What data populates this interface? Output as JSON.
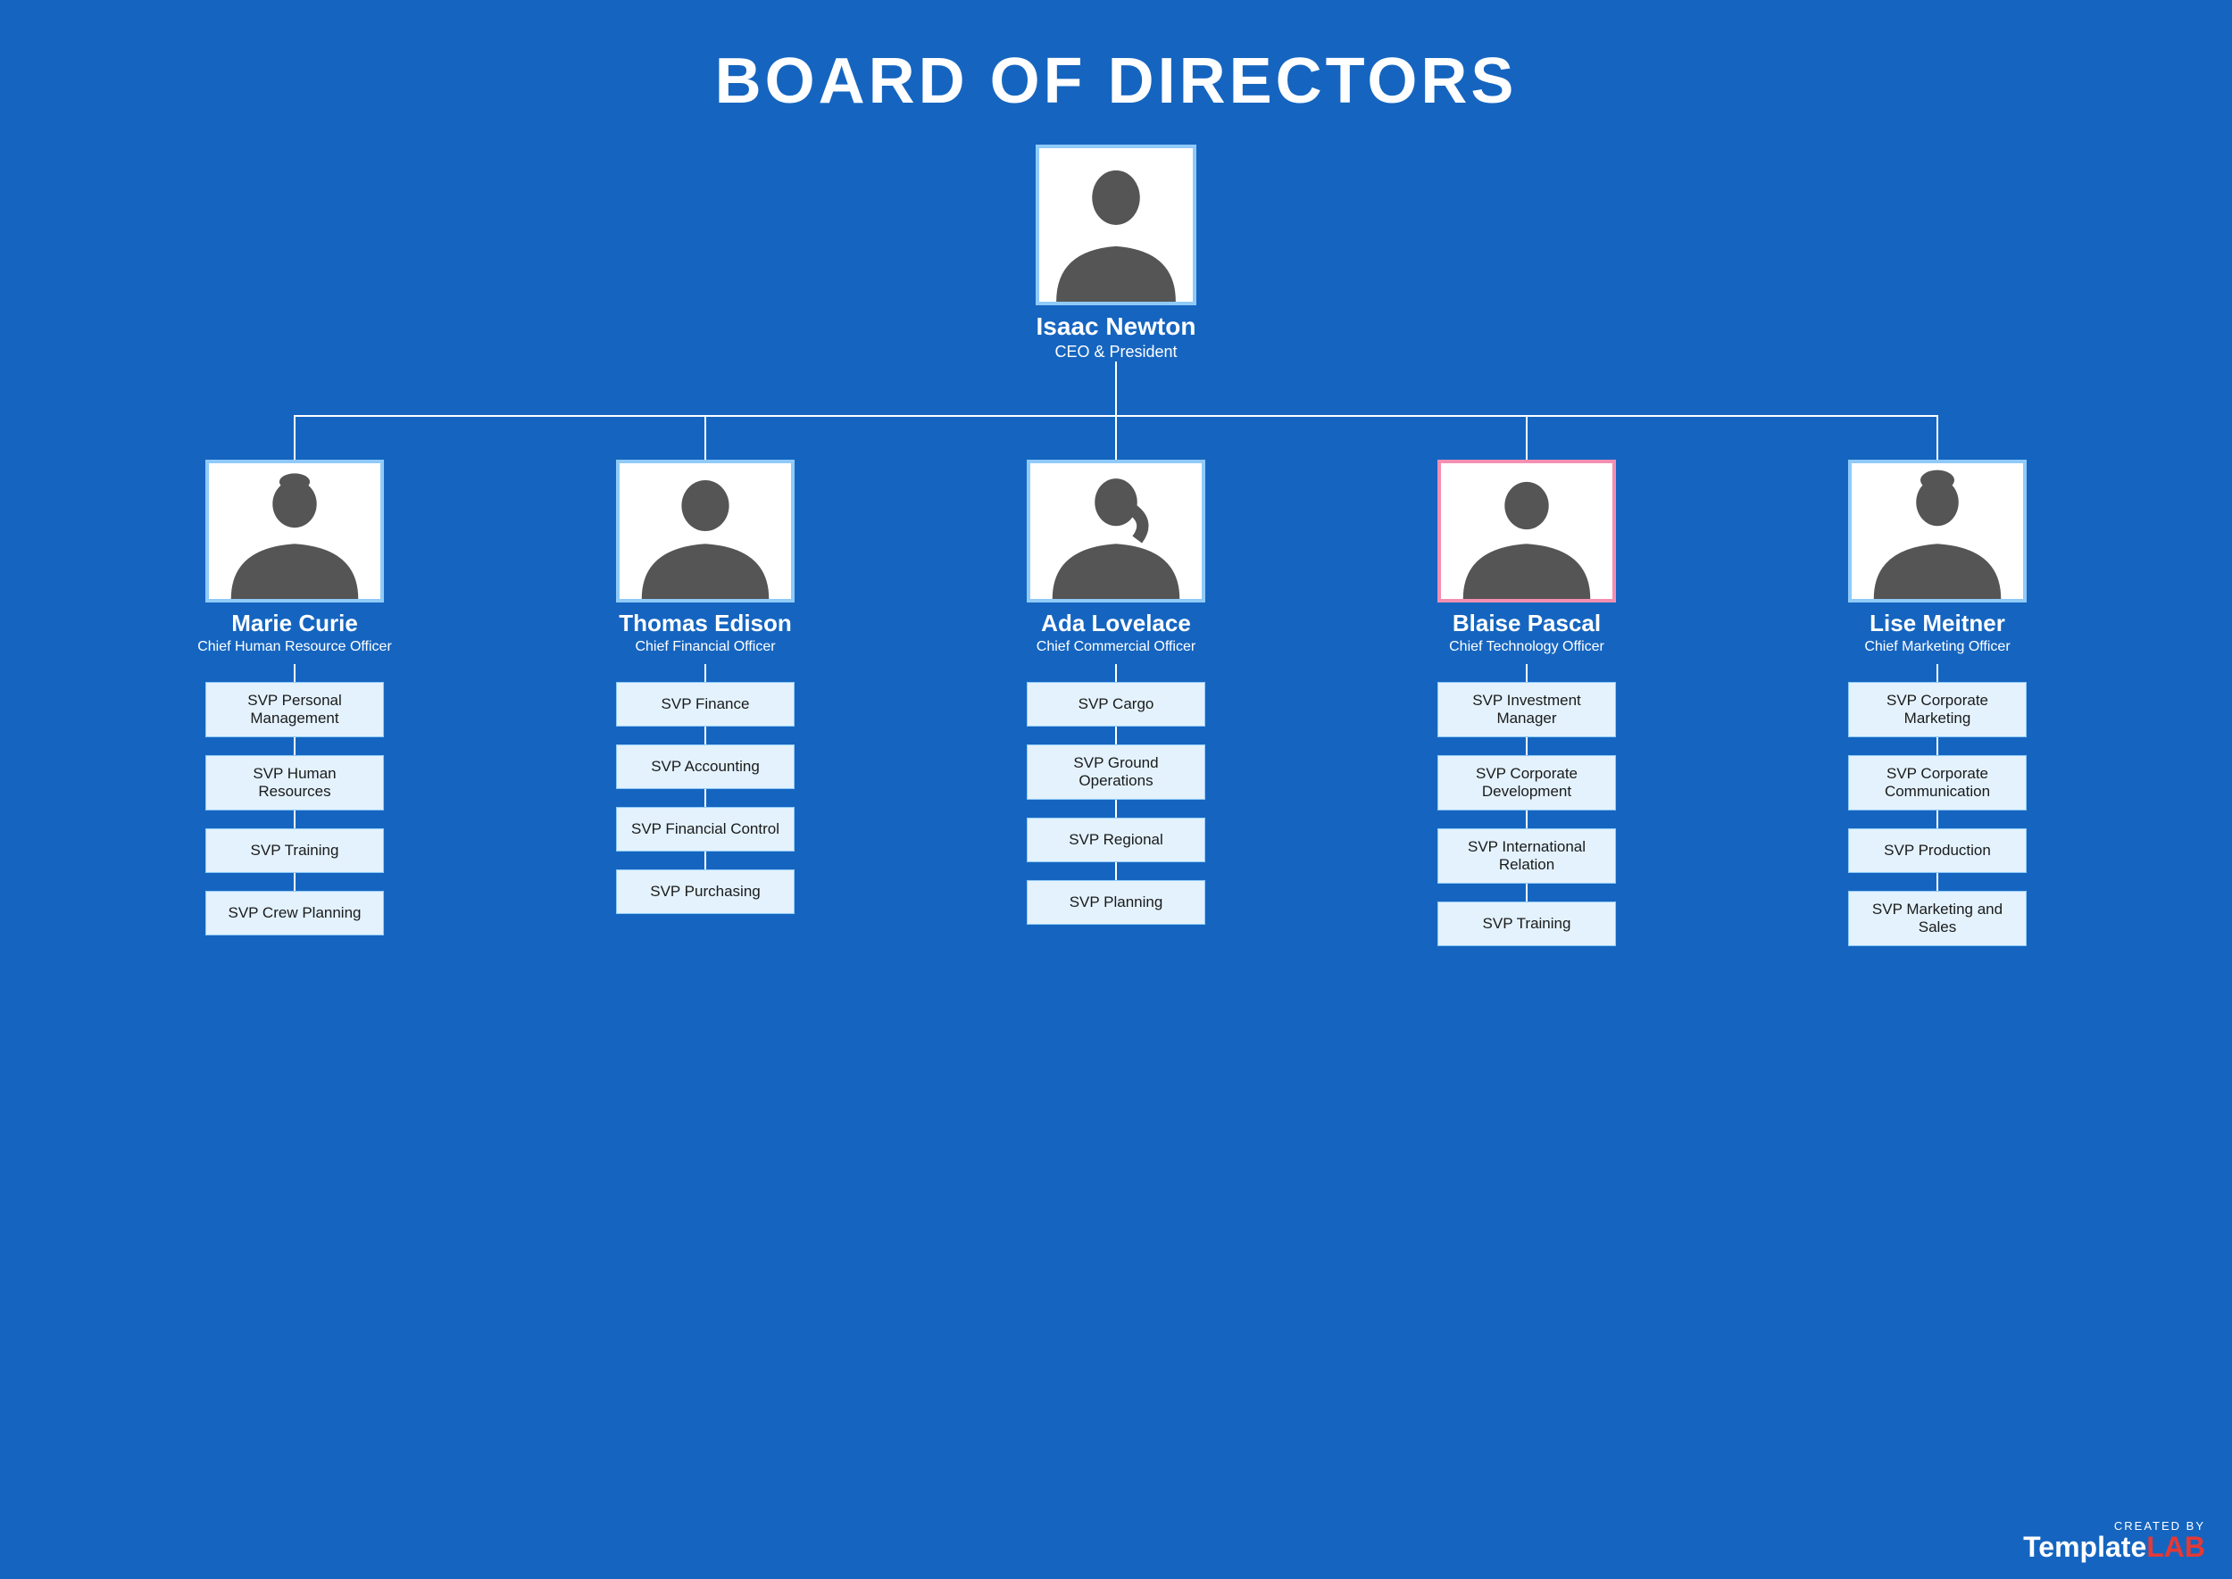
{
  "title": "BOARD OF DIRECTORS",
  "ceo": {
    "name": "Isaac Newton",
    "role": "CEO & President"
  },
  "directors": [
    {
      "name": "Marie Curie",
      "role": "Chief Human Resource Officer",
      "gender": "female",
      "svps": [
        "SVP Personal Management",
        "SVP Human Resources",
        "SVP Training",
        "SVP Crew Planning"
      ]
    },
    {
      "name": "Thomas Edison",
      "role": "Chief Financial Officer",
      "gender": "male",
      "svps": [
        "SVP Finance",
        "SVP Accounting",
        "SVP Financial Control",
        "SVP Purchasing"
      ]
    },
    {
      "name": "Ada Lovelace",
      "role": "Chief Commercial Officer",
      "gender": "female",
      "svps": [
        "SVP Cargo",
        "SVP Ground Operations",
        "SVP Regional",
        "SVP Planning"
      ]
    },
    {
      "name": "Blaise Pascal",
      "role": "Chief Technology Officer",
      "gender": "male",
      "svps": [
        "SVP Investment Manager",
        "SVP Corporate Development",
        "SVP International Relation",
        "SVP Training"
      ]
    },
    {
      "name": "Lise Meitner",
      "role": "Chief Marketing Officer",
      "gender": "female",
      "svps": [
        "SVP Corporate Marketing",
        "SVP Corporate Communication",
        "SVP Production",
        "SVP Marketing and Sales"
      ]
    }
  ],
  "watermark": {
    "created_by": "CREATED BY",
    "template": "Template",
    "lab": "LAB"
  }
}
